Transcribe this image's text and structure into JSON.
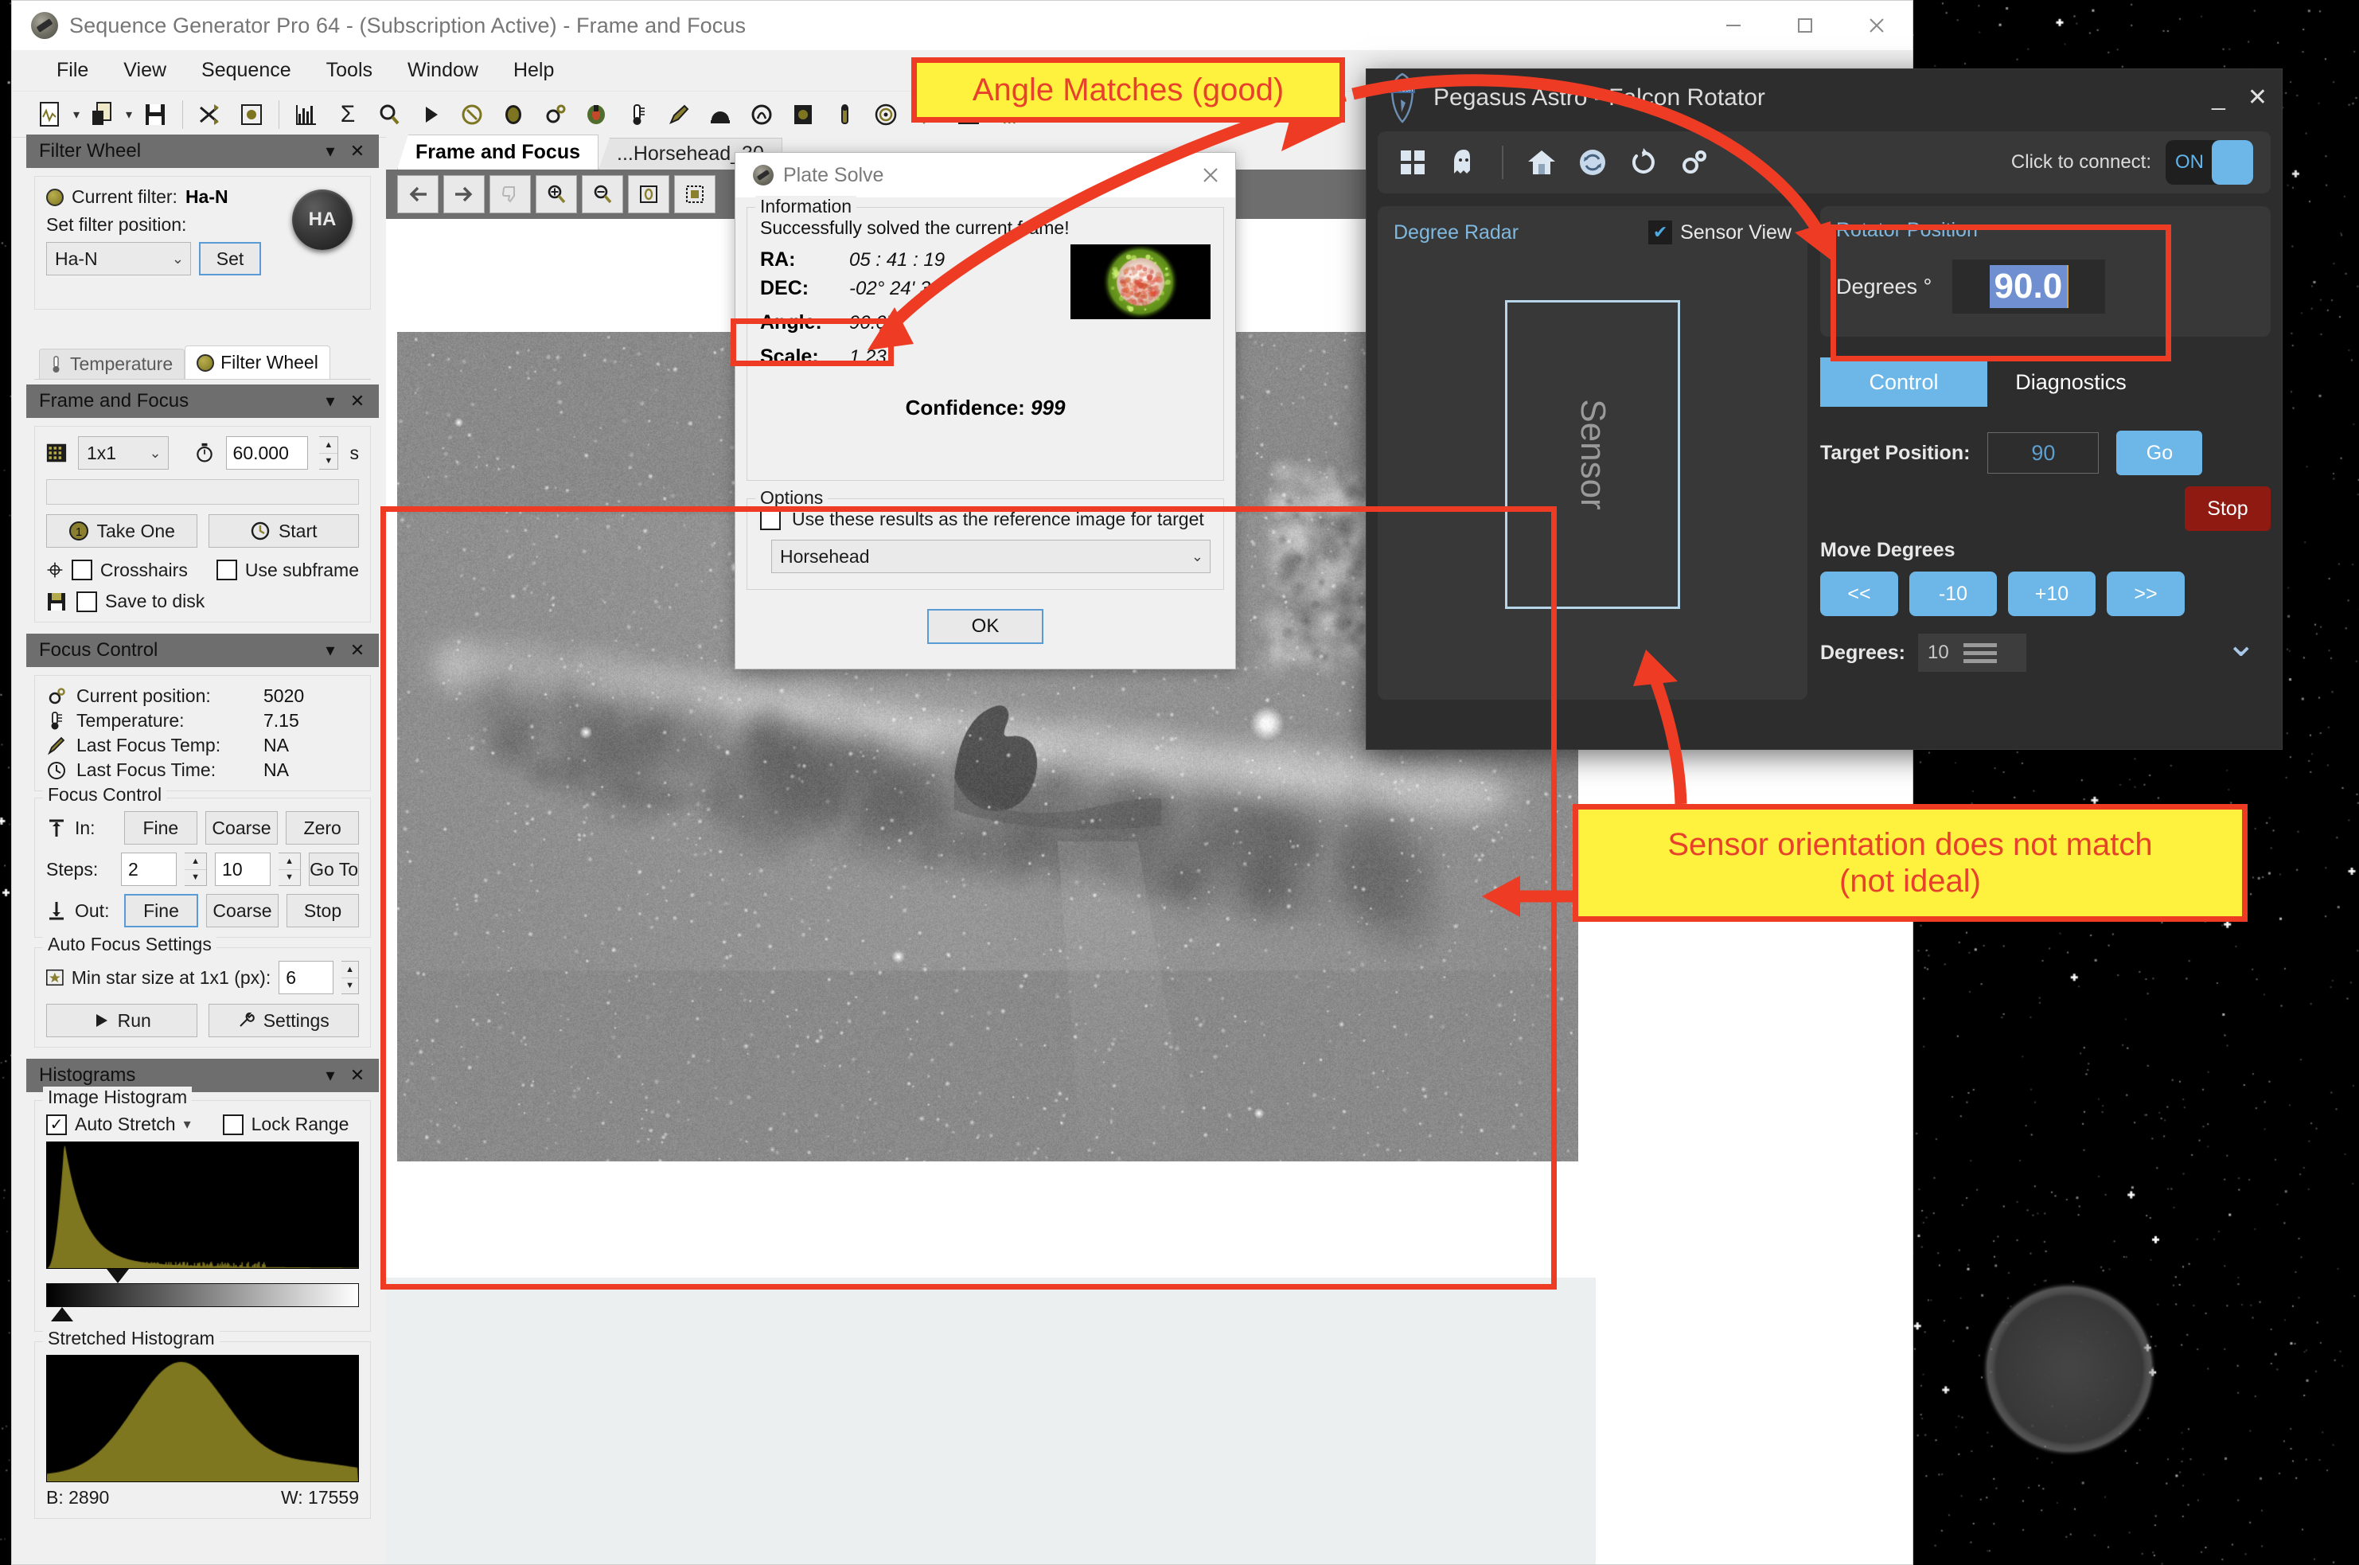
{
  "app": {
    "title": "Sequence Generator Pro 64 - (Subscription Active) - Frame and Focus",
    "window_controls": {
      "minimize": "minimize-icon",
      "maximize": "maximize-icon",
      "close": "close-icon"
    },
    "menu": [
      "File",
      "View",
      "Sequence",
      "Tools",
      "Window",
      "Help"
    ],
    "toolbar_icons": [
      "new-sequence-icon",
      "open-sequence-icon",
      "save-sequence-icon",
      "shuffle-icon",
      "settings-target-icon",
      "histogram-icon",
      "sigma-icon",
      "plate-solve-search-icon",
      "run-icon",
      "rotator-icon",
      "camera-icon",
      "gear-cog-icon",
      "telescope-icon",
      "thermometer-icon",
      "focuser-pen-icon",
      "dome-icon",
      "meridian-flip-icon",
      "filter-wheel-icon",
      "guider-icon",
      "target-icon",
      "validate-check-icon",
      "graph-icon",
      "weather-icon"
    ]
  },
  "document_tabs": [
    {
      "label": "Frame and Focus",
      "active": true
    },
    {
      "label": "...Horsehead_30",
      "active": false
    }
  ],
  "image_toolbar": [
    "back-arrow-icon",
    "forward-arrow-icon",
    "thumbs-down-icon",
    "zoom-in-icon",
    "zoom-out-icon",
    "fit-frame-icon",
    "crop-icon"
  ],
  "panels": {
    "filter_wheel": {
      "header": "Filter Wheel",
      "current_filter_label": "Current filter:",
      "current_filter_value": "Ha-N",
      "set_position_label": "Set filter position:",
      "position_select_value": "Ha-N",
      "set_button": "Set",
      "knob_label": "HA",
      "tabs": [
        {
          "label": "Temperature",
          "icon": "thermometer-icon",
          "active": false
        },
        {
          "label": "Filter Wheel",
          "icon": "filter-wheel-icon",
          "active": true
        }
      ]
    },
    "frame_and_focus": {
      "header": "Frame and Focus",
      "binning_value": "1x1",
      "exposure_value": "60.000",
      "exposure_unit": "s",
      "take_one_button": "Take One",
      "start_button": "Start",
      "crosshairs_label": "Crosshairs",
      "crosshairs_checked": false,
      "use_subframe_label": "Use subframe",
      "use_subframe_checked": false,
      "save_to_disk_label": "Save to disk",
      "save_to_disk_checked": false
    },
    "focus_control": {
      "header": "Focus Control",
      "stats": [
        {
          "label": "Current position:",
          "value": "5020",
          "icon": "gear-icon"
        },
        {
          "label": "Temperature:",
          "value": "7.15",
          "icon": "thermometer-icon"
        },
        {
          "label": "Last Focus Temp:",
          "value": "NA",
          "icon": "pen-thermometer-icon"
        },
        {
          "label": "Last Focus Time:",
          "value": "NA",
          "icon": "clock-icon"
        }
      ],
      "group_label": "Focus Control",
      "in_label": "In:",
      "in_fine": "Fine",
      "in_coarse": "Coarse",
      "in_zero": "Zero",
      "steps_label": "Steps:",
      "steps_value_1": "2",
      "steps_value_2": "10",
      "go_to_button": "Go To",
      "out_label": "Out:",
      "out_fine": "Fine",
      "out_coarse": "Coarse",
      "out_stop": "Stop",
      "auto_focus_label": "Auto Focus Settings",
      "min_star_label": "Min star size at 1x1 (px):",
      "min_star_value": "6",
      "run_button": "Run",
      "settings_button": "Settings"
    },
    "histograms": {
      "header": "Histograms",
      "image_histogram_label": "Image Histogram",
      "auto_stretch_label": "Auto Stretch",
      "auto_stretch_checked": true,
      "lock_range_label": "Lock Range",
      "lock_range_checked": false,
      "stretched_histogram_label": "Stretched Histogram",
      "black_point": "B: 2890",
      "white_point": "W: 17559"
    }
  },
  "plate_solve": {
    "title": "Plate Solve",
    "information_legend": "Information",
    "status_text": "Successfully solved the current frame!",
    "fields": [
      {
        "key": "RA:",
        "value": "05 : 41 : 19"
      },
      {
        "key": "DEC:",
        "value": "-02° 24' 3"
      },
      {
        "key": "Angle:",
        "value": "90.07"
      },
      {
        "key": "Scale:",
        "value": "1.23"
      }
    ],
    "confidence_label": "Confidence:",
    "confidence_value": "999",
    "options_legend": "Options",
    "use_reference_label": "Use these results as the reference image for target",
    "use_reference_checked": false,
    "target_select_value": "Horsehead",
    "ok_button": "OK",
    "close_icon": "close-icon"
  },
  "falcon": {
    "title": "Pegasus Astro - Falcon Rotator",
    "minimize_icon": "minimize-icon",
    "close_icon": "close-icon",
    "toolbar_icons": [
      "dashboard-grid-icon",
      "ghost-icon",
      "home-icon",
      "sync-refresh-icon",
      "reset-rotate-icon",
      "settings-gears-icon"
    ],
    "connect_label": "Click to connect:",
    "connect_state": "ON",
    "radar": {
      "title": "Degree Radar",
      "sensor_view_label": "Sensor View",
      "sensor_view_checked": true,
      "sensor_label": "Sensor"
    },
    "rotator_position": {
      "title": "Rotator Position",
      "degrees_label": "Degrees °",
      "degrees_value": "90.0"
    },
    "tabs": [
      {
        "label": "Control",
        "active": true
      },
      {
        "label": "Diagnostics",
        "active": false
      }
    ],
    "control": {
      "target_position_label": "Target Position:",
      "target_position_value": "90",
      "go_button": "Go",
      "stop_button": "Stop",
      "move_degrees_label": "Move Degrees",
      "move_buttons": [
        "<<",
        "-10",
        "+10",
        ">>"
      ],
      "degrees_label": "Degrees:",
      "degrees_value": "10",
      "expand_icon": "chevron-down-icon"
    }
  },
  "annotations": {
    "callout_1": "Angle Matches (good)",
    "callout_2_line1": "Sensor orientation does not match",
    "callout_2_line2": "(not ideal)",
    "highlight_color": "#EE3B24",
    "callout_bg": "#FFF23F"
  }
}
